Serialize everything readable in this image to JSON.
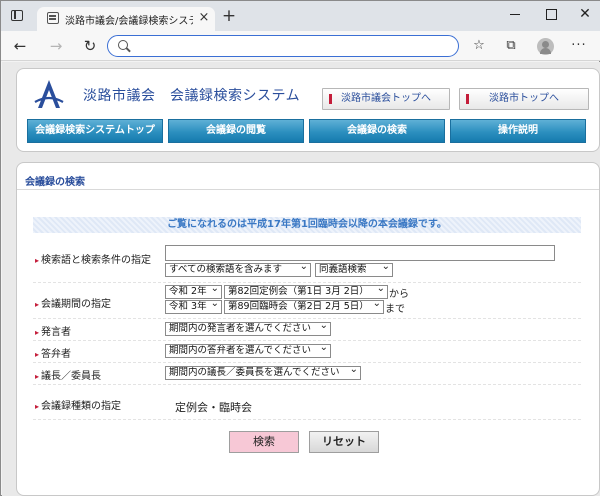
{
  "browser": {
    "tab_title": "淡路市議会/会議録検索システム",
    "tab_close": "×",
    "new_tab": "+",
    "address_value": "",
    "icons": [
      "tab-actions-icon",
      "favicon-icon",
      "close-icon",
      "plus-icon",
      "back-arrow-icon",
      "forward-arrow-icon",
      "reload-icon",
      "search-icon",
      "favorites-icon",
      "collections-icon",
      "profile-icon",
      "more-icon"
    ]
  },
  "header": {
    "title": "淡路市議会　会議録検索システム",
    "link_council": "淡路市議会トップへ",
    "link_city": "淡路市トップへ",
    "nav": [
      "会議録検索システムトップ",
      "会議録の閲覧",
      "会議録の検索",
      "操作説明"
    ]
  },
  "search": {
    "section_title": "会議録の検索",
    "notice": "ご覧になれるのは平成17年第1回臨時会以降の本会議録です。",
    "keyword": {
      "label": "検索語と検索条件の指定",
      "value": "",
      "condition": "すべての検索語を含みます",
      "synonym": "同義語検索"
    },
    "period": {
      "label": "会議期間の指定",
      "from_year": "令和 2年",
      "from_session": "第82回定例会（第1日 3月 2日）",
      "from_suffix": "から",
      "to_year": "令和 3年",
      "to_session": "第89回臨時会（第2日 2月 5日）",
      "to_suffix": "まで"
    },
    "speaker": {
      "label": "発言者",
      "value": "期間内の発言者を選んでください"
    },
    "answerer": {
      "label": "答弁者",
      "value": "期間内の答弁者を選んでください"
    },
    "chair": {
      "label": "議長／委員長",
      "value": "期間内の議長／委員長を選んでください"
    },
    "kind": {
      "label": "会議録種類の指定",
      "value": "定例会・臨時会"
    },
    "btn_search": "検索",
    "btn_reset": "リセット"
  }
}
